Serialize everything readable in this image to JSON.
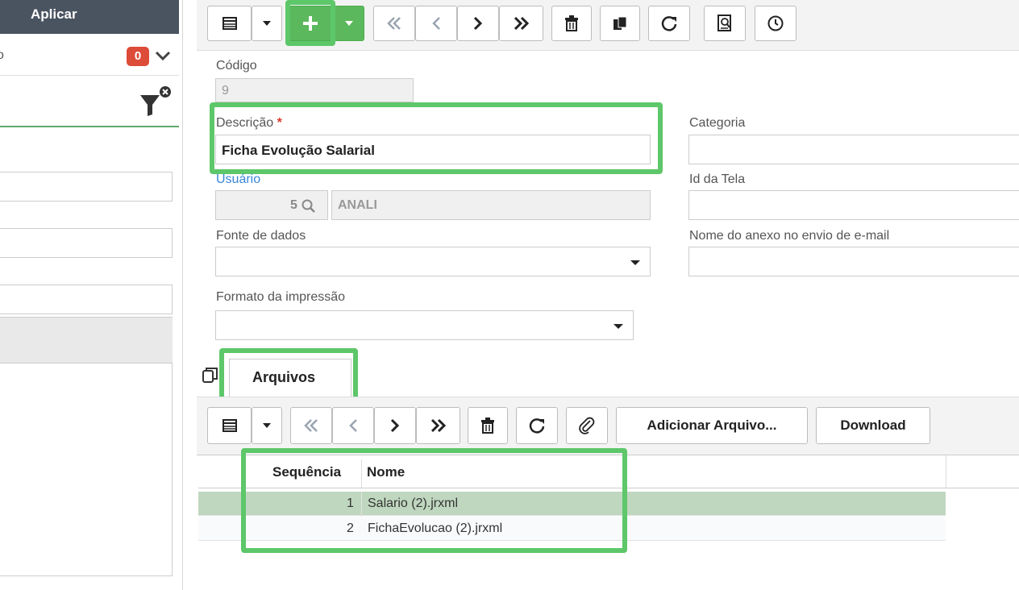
{
  "filter_panel": {
    "apply_label": "Aplicar",
    "row_fragment": "o",
    "filter_count": "0"
  },
  "toolbar": {
    "icons": [
      "grid-icon",
      "caret-down-icon",
      "plus-icon",
      "caret-down-icon",
      "first-icon",
      "prev-icon",
      "next-icon",
      "last-icon",
      "trash-icon",
      "copy-icon",
      "refresh-icon",
      "report-icon",
      "clock-icon"
    ]
  },
  "form": {
    "codigo_label": "Código",
    "codigo_value": "9",
    "descricao_label": "Descrição",
    "descricao_required": "*",
    "descricao_value": "Ficha Evolução Salarial",
    "usuario_label": "Usuário",
    "usuario_id": "5",
    "usuario_name": "ANALI",
    "fonte_label": "Fonte de dados",
    "fonte_value": "",
    "formato_label": "Formato da impressão",
    "formato_value": "",
    "categoria_label": "Categoria",
    "categoria_value": "",
    "idtela_label": "Id da Tela",
    "idtela_value": "",
    "anexo_label": "Nome do anexo no envio de e-mail",
    "anexo_value": ""
  },
  "tabs": {
    "active": "Arquivos"
  },
  "files_toolbar": {
    "add_file_label": "Adicionar Arquivo...",
    "download_label": "Download"
  },
  "files_grid": {
    "columns": [
      "Sequência",
      "Nome"
    ],
    "rows": [
      {
        "seq": "1",
        "name": "Salario (2).jrxml",
        "selected": true
      },
      {
        "seq": "2",
        "name": "FichaEvolucao (2).jrxml",
        "selected": false
      }
    ]
  },
  "colors": {
    "highlight": "#5dc76a",
    "primary_green": "#5cb85c",
    "badge_red": "#dd4b39",
    "selected_row": "#bfd7bf",
    "link_blue": "#3a87d9"
  }
}
